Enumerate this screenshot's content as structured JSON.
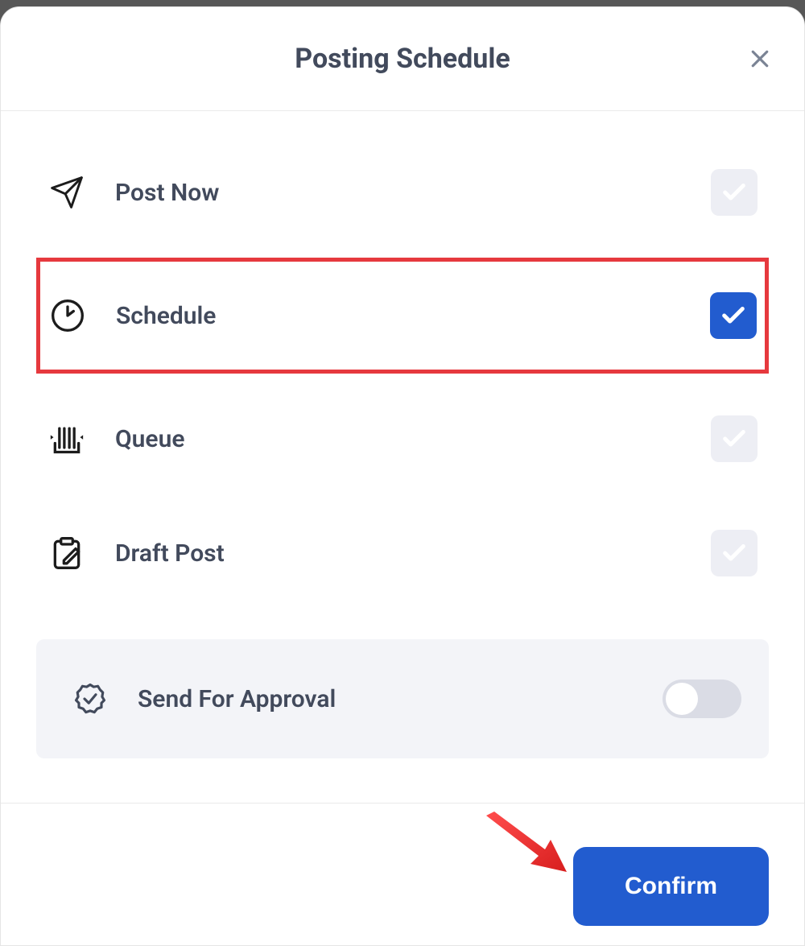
{
  "header": {
    "title": "Posting Schedule"
  },
  "options": {
    "post_now": {
      "label": "Post Now",
      "checked": false
    },
    "schedule": {
      "label": "Schedule",
      "checked": true,
      "highlighted": true
    },
    "queue": {
      "label": "Queue",
      "checked": false
    },
    "draft": {
      "label": "Draft Post",
      "checked": false
    }
  },
  "approval": {
    "label": "Send For Approval",
    "enabled": false
  },
  "footer": {
    "confirm_label": "Confirm"
  }
}
